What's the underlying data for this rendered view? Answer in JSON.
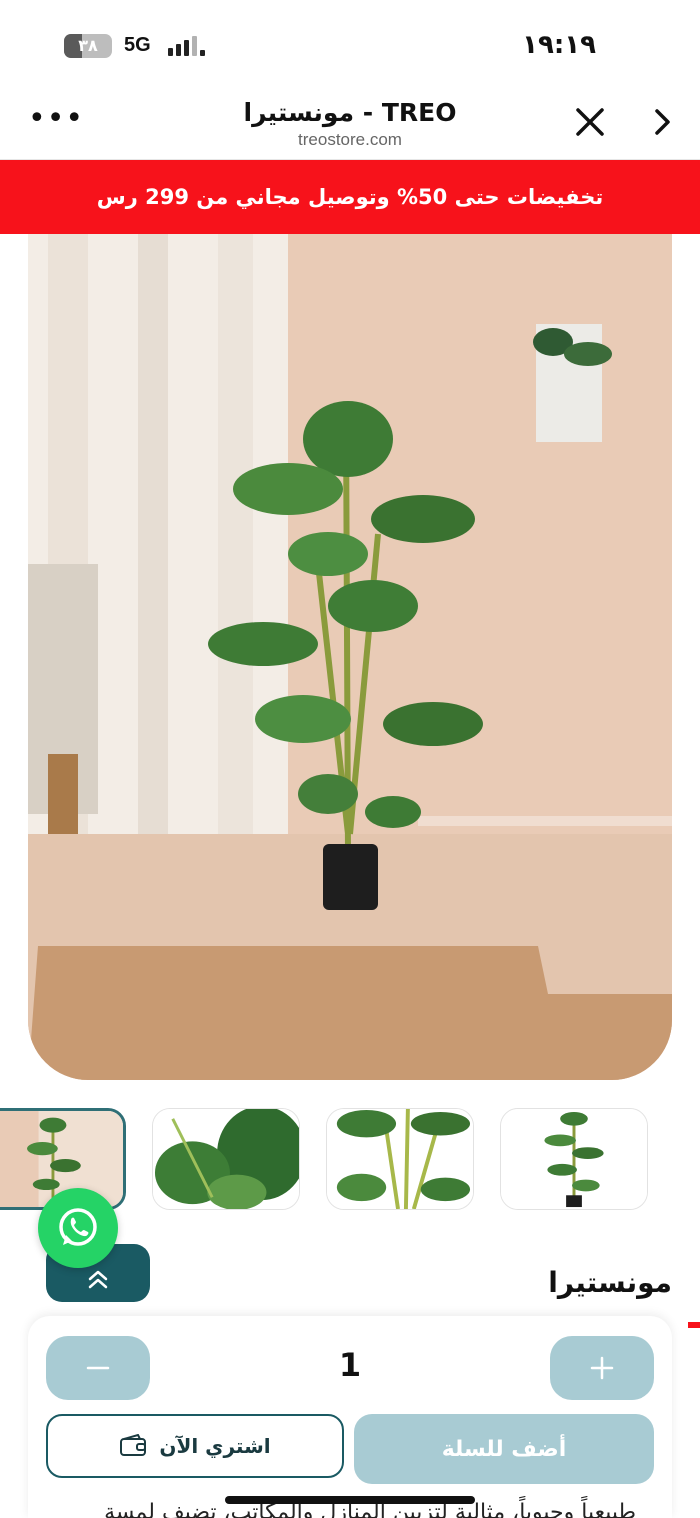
{
  "status_bar": {
    "battery": "٣٨",
    "battery_level": 0.38,
    "network": "5G",
    "time": "١٩:١٩"
  },
  "browser": {
    "title": "مونستيرا - TREO",
    "domain": "treostore.com",
    "icons": [
      "more-icon",
      "close-icon",
      "chevron-right-icon"
    ]
  },
  "promo": {
    "text": "تخفيضات حتى 50% وتوصيل مجاني من 299 رس",
    "color": "#f7121b"
  },
  "product": {
    "name": "مونستيرا",
    "quantity": "1",
    "buy_now_label": "اشتري الآن",
    "add_to_cart_label": "أضف للسلة",
    "description_peek": "طبيعياً وحيوياً، مثالية لتزيين المنازل والمكاتب، تضيف لمسة"
  },
  "thumbnails": [
    {
      "alt": "plant in room",
      "selected": true
    },
    {
      "alt": "leaf close-up",
      "selected": false
    },
    {
      "alt": "stems close-up",
      "selected": false
    },
    {
      "alt": "plant on white",
      "selected": false
    }
  ],
  "colors": {
    "accent": "#1a5a63",
    "button_light": "#a8cbd3",
    "whatsapp": "#25d366"
  }
}
